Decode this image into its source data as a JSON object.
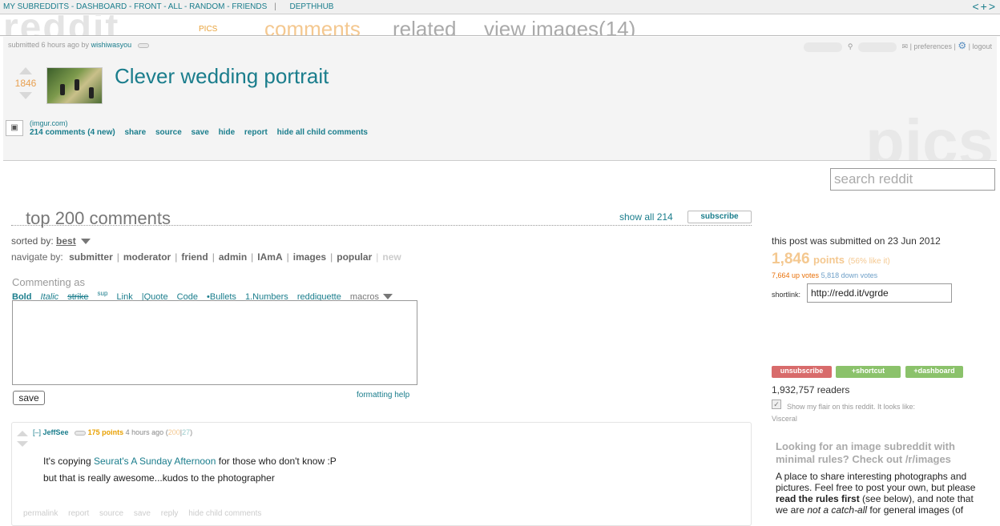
{
  "topbar": {
    "links": "MY SUBREDDITS - DASHBOARD - FRONT - ALL - RANDOM - FRIENDS",
    "sep": "|",
    "extra": "DEPTHHUB",
    "arrows": "<+>"
  },
  "header": {
    "logo": "reddit",
    "subreddit": "PICS",
    "tabs": [
      "comments",
      "related",
      "view images(14)"
    ]
  },
  "post": {
    "submitted_prefix": "submitted 6 hours ago by",
    "author": "wishiwasyou",
    "userbar_rest": "| preferences |",
    "logout": "logout",
    "score": "1846",
    "title": "Clever wedding portrait",
    "domain": "(imgur.com)",
    "buttons": [
      "214 comments (4 new)",
      "share",
      "source",
      "save",
      "hide",
      "report",
      "hide all child comments"
    ],
    "watermark": "pics"
  },
  "search": {
    "placeholder": "search reddit"
  },
  "comments_panel": {
    "title": "top 200 comments",
    "show_all": "show all 214",
    "subscribe": "subscribe",
    "sorted_label": "sorted by:",
    "sorted_value": "best",
    "navigate_label": "navigate by:",
    "navigate_items": [
      "submitter",
      "moderator",
      "friend",
      "admin",
      "IAmA",
      "images",
      "popular"
    ],
    "navigate_new": "new"
  },
  "editor": {
    "commenting_as": "Commenting as",
    "tools": [
      "Bold",
      "Italic",
      "strike",
      "sup",
      "Link",
      "|Quote",
      "Code",
      "•Bullets",
      "1.Numbers",
      "reddiquette",
      "macros"
    ],
    "save": "save",
    "formatting_help": "formatting help"
  },
  "comment": {
    "collapse": "[–]",
    "author": "JeffSee",
    "points": "175 points",
    "time": "4 hours ago",
    "paren_open": "(",
    "up": "200",
    "bar": "|",
    "down": "27",
    "paren_close": ")",
    "line1_pre": "It's copying ",
    "line1_link": "Seurat's A Sunday Afternoon",
    "line1_post": " for those who don't know :P",
    "line2": "but that is really awesome...kudos to the photographer",
    "links": [
      "permalink",
      "report",
      "source",
      "save",
      "reply",
      "hide child comments"
    ]
  },
  "sidebar": {
    "submitted_on": "this post was submitted on 23 Jun 2012",
    "points_num": "1,846",
    "points_label": "points",
    "like": "(56% like it)",
    "up_votes": "7,664 up votes",
    "down_votes": "5,818 down votes",
    "shortlink_label": "shortlink:",
    "shortlink_value": "http://redd.it/vgrde",
    "btn_unsubscribe": "unsubscribe",
    "btn_shortcut": "+shortcut",
    "btn_dashboard": "+dashboard",
    "readers": "1,932,757 readers",
    "flair_text": "Show my flair on this reddit. It looks like:",
    "flair_value": "Visceral",
    "promo": "Looking for an image subreddit with minimal rules? Check out /r/images",
    "desc_1": "A place to share interesting photographs and pictures. Feel free to post your own, but please ",
    "desc_bold": "read the rules first",
    "desc_2": " (see below), and note that we are ",
    "desc_italic": "not a catch-all",
    "desc_3": " for general images (of"
  },
  "colors": {
    "link": "#1a7d8c",
    "unsubscribe": "#d86b6b",
    "shortcut": "#8bc26b",
    "dashboard": "#8bc26b"
  }
}
